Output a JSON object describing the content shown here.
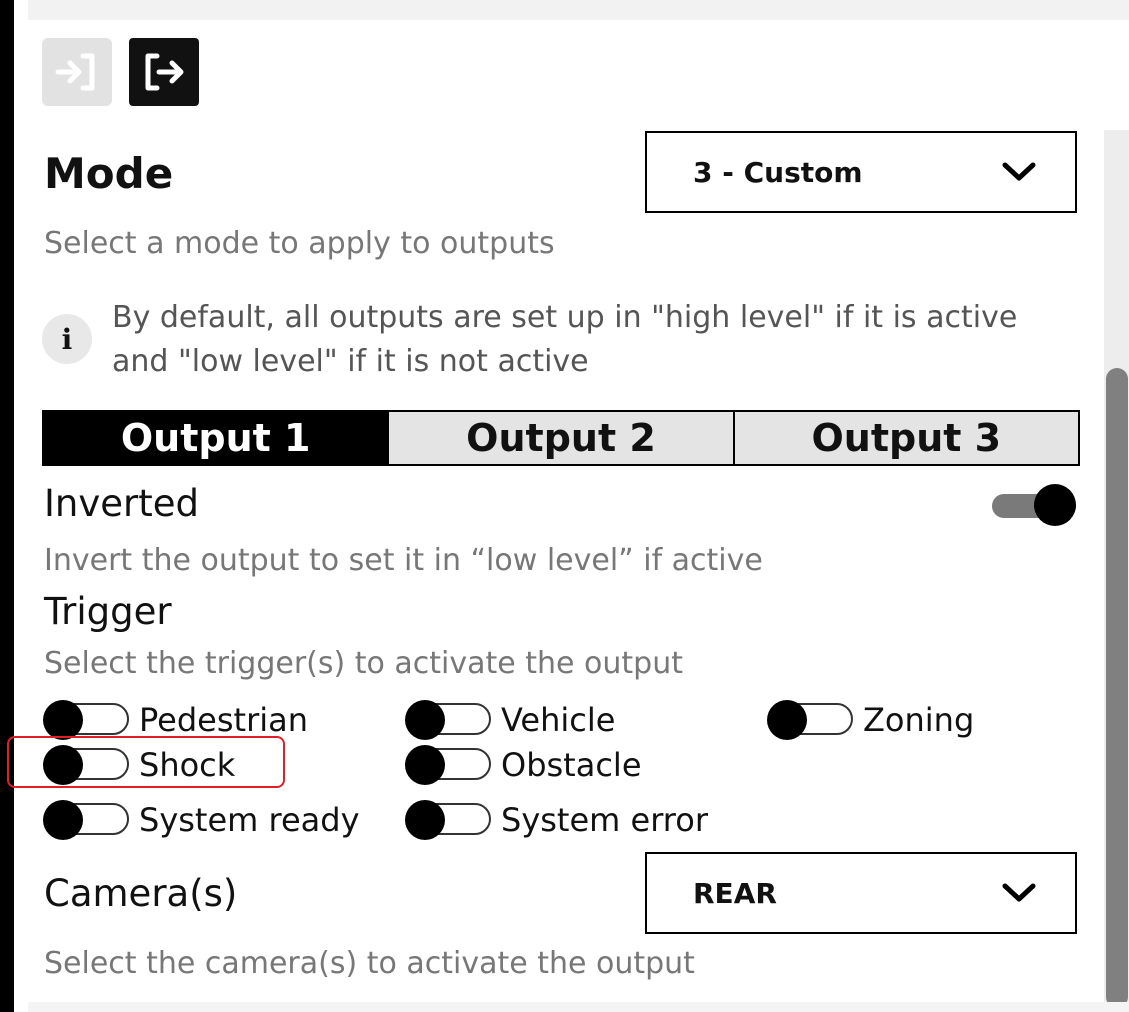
{
  "mode": {
    "title": "Mode",
    "selected": "3 - Custom",
    "description": "Select a mode to apply to outputs",
    "info": "By default, all outputs are set up in \"high level\" if it is active and \"low level\" if it is not active"
  },
  "tabs": [
    {
      "label": "Output 1",
      "active": true
    },
    {
      "label": "Output 2",
      "active": false
    },
    {
      "label": "Output 3",
      "active": false
    }
  ],
  "inverted": {
    "label": "Inverted",
    "enabled": true,
    "description": "Invert the output to set it in “low level” if active"
  },
  "trigger": {
    "label": "Trigger",
    "description": "Select the trigger(s) to activate the output",
    "items": [
      {
        "label": "Pedestrian",
        "enabled": false
      },
      {
        "label": "Vehicle",
        "enabled": false
      },
      {
        "label": "Zoning",
        "enabled": false
      },
      {
        "label": "Shock",
        "enabled": false
      },
      {
        "label": "Obstacle",
        "enabled": false
      },
      {
        "label": "System ready",
        "enabled": false
      },
      {
        "label": "System error",
        "enabled": false
      }
    ]
  },
  "camera": {
    "label": "Camera(s)",
    "selected": "REAR",
    "description": "Select the camera(s) to activate the output"
  },
  "icons": {
    "login": "login-icon",
    "logout": "logout-icon",
    "info": "info-icon",
    "chevron": "chevron-down-icon"
  },
  "colors": {
    "active_tab": "#000000",
    "inactive_tab": "#e4e4e4",
    "highlight": "#e21f26",
    "scrollbar": "#808080"
  }
}
